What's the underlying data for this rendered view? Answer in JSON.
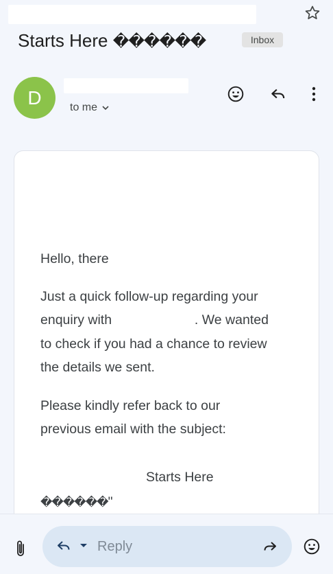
{
  "email": {
    "subject_text": "Starts Here",
    "subject_glyphs": "������",
    "label_badge": "Inbox",
    "sender_initial": "D",
    "recipient_text": "to me"
  },
  "body": {
    "greeting": "Hello, there",
    "p1_line1": "Just a quick follow-up regarding your",
    "p1_line2_start": "enquiry with",
    "p1_line2_end": ". We wanted",
    "p1_line3": "to check if you had a chance to review",
    "p1_line4": "the details we sent.",
    "p2_line1": "Please kindly refer back to our",
    "p2_line2": "previous email with the subject:",
    "quoted_subject_text": "Starts Here",
    "quoted_subject_glyphs": "������",
    "quoted_subject_end": "\""
  },
  "compose": {
    "reply_placeholder": "Reply"
  },
  "icons": {
    "star": "star-icon",
    "emoji": "emoji-icon",
    "reply": "reply-icon",
    "more": "more-vert-icon",
    "attach": "attach-icon",
    "forward": "forward-icon",
    "dropdown": "dropdown-icon",
    "chevron": "chevron-down-icon"
  },
  "colors": {
    "avatar": "#8bc34a",
    "reply_pill": "#dbe7f4",
    "page_background": "#f3f6fc"
  }
}
